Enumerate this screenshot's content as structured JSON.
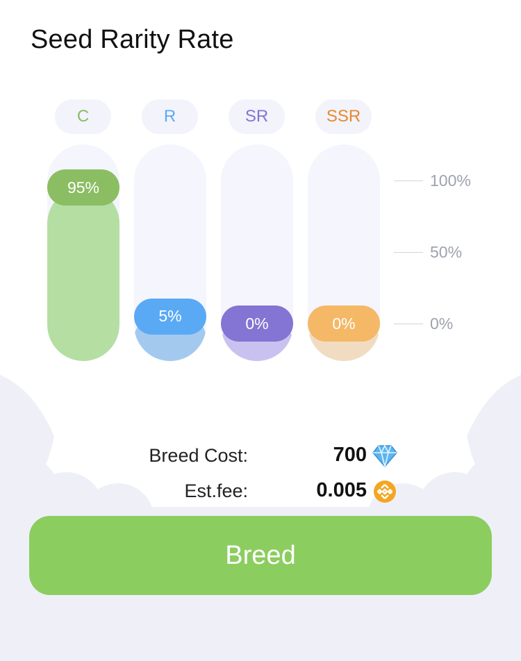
{
  "title": "Seed Rarity Rate",
  "chart_data": {
    "type": "bar",
    "categories": [
      "C",
      "R",
      "SR",
      "SSR"
    ],
    "values": [
      95,
      5,
      0,
      0
    ],
    "value_labels": [
      "95%",
      "5%",
      "0%",
      "0%"
    ],
    "y_tick_labels": [
      "100%",
      "50%",
      "0%"
    ],
    "ylim": [
      0,
      100
    ],
    "category_colors": [
      "#8bbd62",
      "#5aa9f5",
      "#8474d3",
      "#f4b866"
    ],
    "fill_colors": [
      "#b5dea3",
      "#a4c9ef",
      "#c9c2f0",
      "#f1dcc2"
    ],
    "label_colors": [
      "#8bbd62",
      "#5aa9f5",
      "#8474d3",
      "#e8892e"
    ]
  },
  "costs": {
    "breed_cost_label": "Breed Cost:",
    "breed_cost_value": "700",
    "breed_cost_icon": "diamond-gem-icon",
    "est_fee_label": "Est.fee:",
    "est_fee_value": "0.005",
    "est_fee_icon": "bnb-coin-icon"
  },
  "breed_button_label": "Breed",
  "colors": {
    "button": "#8ccd60",
    "gem": "#5bb5f0",
    "coin": "#f3a623",
    "track": "#f4f5fd",
    "decor": "#eff0f7"
  }
}
